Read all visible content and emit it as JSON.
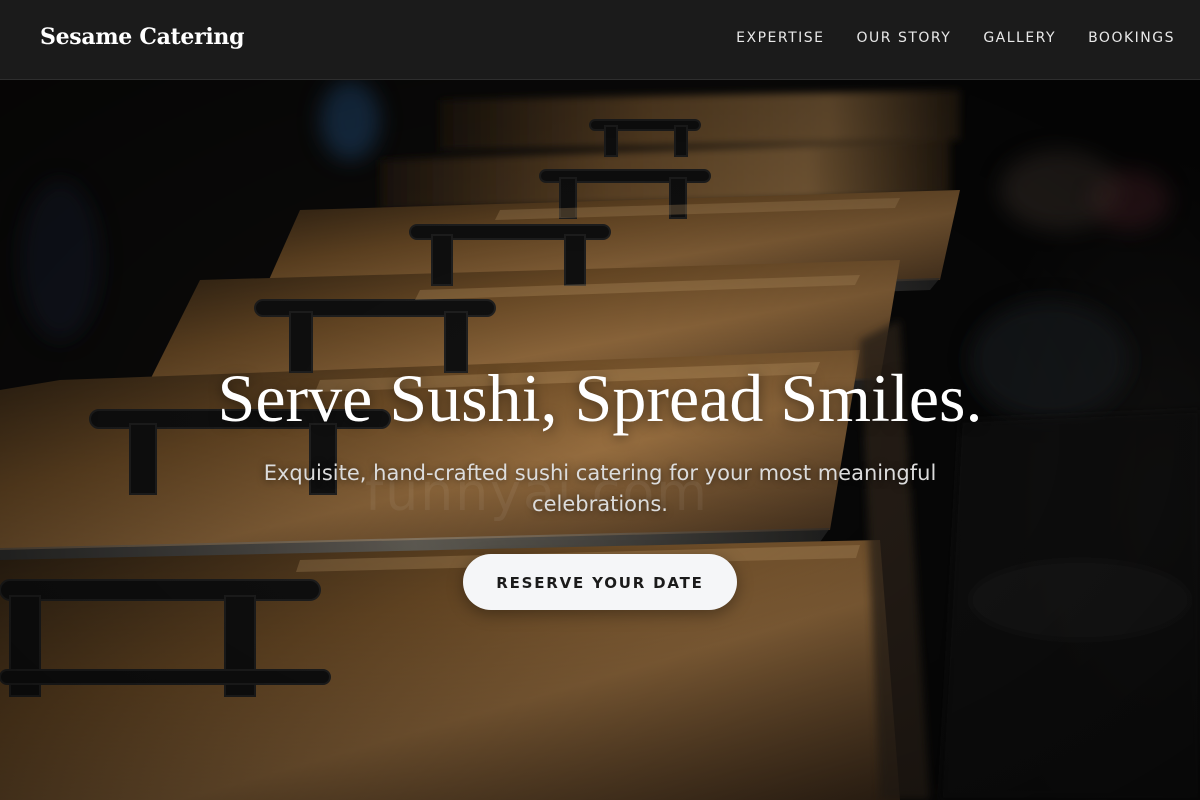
{
  "brand": {
    "name": "Sesame Catering"
  },
  "nav": {
    "items": [
      {
        "label": "EXPERTISE"
      },
      {
        "label": "OUR STORY"
      },
      {
        "label": "GALLERY"
      },
      {
        "label": "BOOKINGS"
      }
    ]
  },
  "hero": {
    "title": "Serve Sushi, Spread Smiles.",
    "subtitle": "Exquisite, hand-crafted sushi catering for your most meaningful celebrations.",
    "cta_label": "RESERVE YOUR DATE",
    "background_image": "chafing-dishes-buffet-photo",
    "watermark": "funnyai.com"
  },
  "colors": {
    "navbar_bg": "#1b1b1b",
    "text_primary": "#ffffff",
    "button_bg": "#f5f6f8",
    "button_text": "#1b1b1b",
    "brass": "#b8864a"
  }
}
